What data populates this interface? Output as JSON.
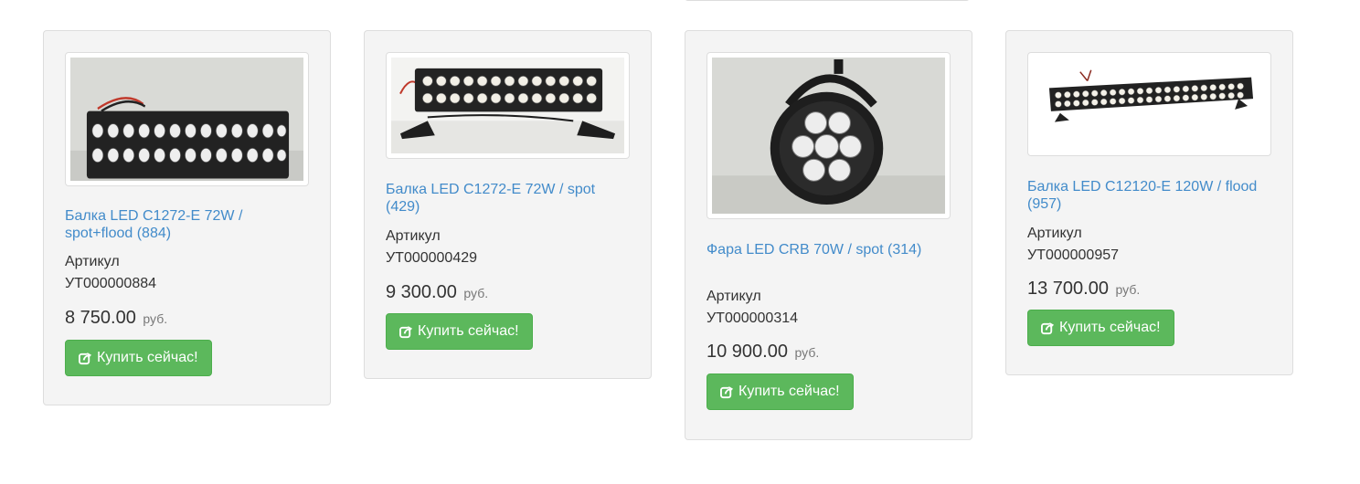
{
  "products": [
    {
      "title": "Балка LED C1272-E 72W / spot+flood (884)",
      "sku_label": "Артикул",
      "sku": "УТ000000884",
      "price": "8 750.00",
      "currency": "руб.",
      "button_label": "Купить сейчас!",
      "image_icon": "led-light-bar-image"
    },
    {
      "title": "Балка LED C1272-E 72W / spot (429)",
      "sku_label": "Артикул",
      "sku": "УТ000000429",
      "price": "9 300.00",
      "currency": "руб.",
      "button_label": "Купить сейчас!",
      "image_icon": "led-light-bar-image"
    },
    {
      "title": "Фара LED CRB 70W / spot (314)",
      "sku_label": "Артикул",
      "sku": "УТ000000314",
      "price": "10 900.00",
      "currency": "руб.",
      "button_label": "Купить сейчас!",
      "image_icon": "round-led-headlight-image"
    },
    {
      "title": "Балка LED C12120-E 120W / flood (957)",
      "sku_label": "Артикул",
      "sku": "УТ000000957",
      "price": "13 700.00",
      "currency": "руб.",
      "button_label": "Купить сейчас!",
      "image_icon": "led-light-bar-image"
    }
  ],
  "colors": {
    "card_background": "#f4f4f4",
    "link": "#428bca",
    "button": "#5cb85c",
    "button_border": "#4cae4c",
    "text": "#333333",
    "muted": "#777777"
  },
  "icons": {
    "button_icon": "share-square-icon"
  }
}
